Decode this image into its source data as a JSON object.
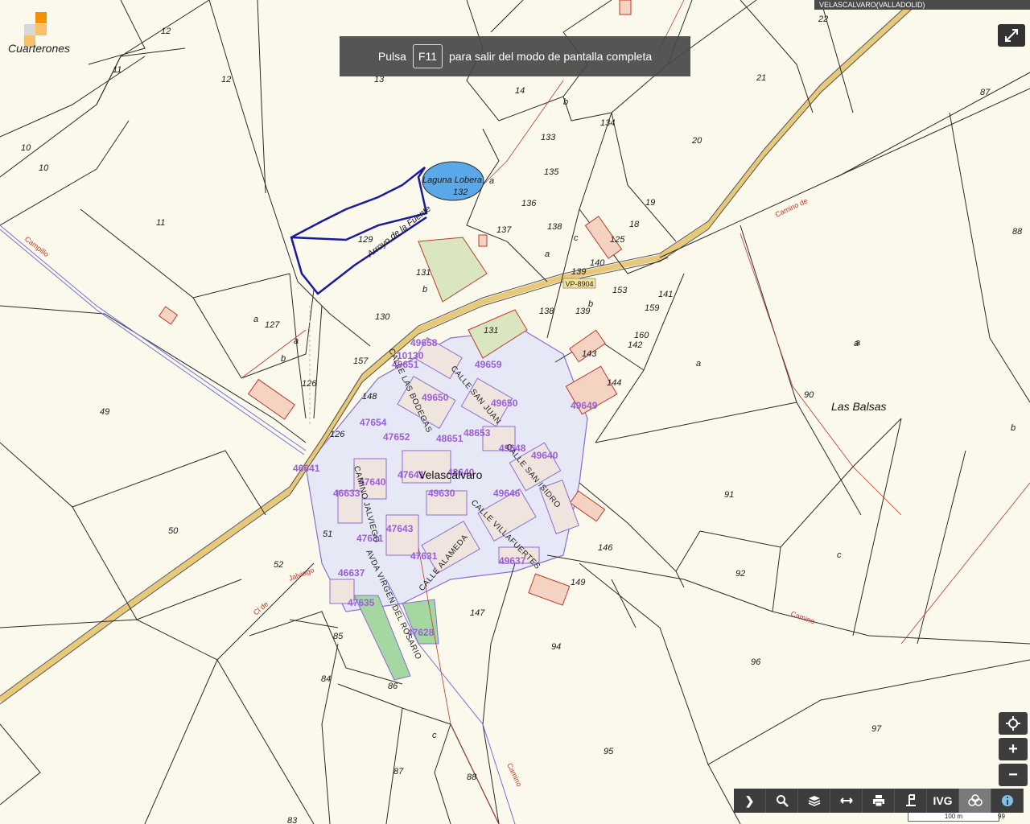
{
  "top_label": "VELASCALVARO(VALLADOLID)",
  "logo_text": "Cuarterones",
  "fullscreen_msg": {
    "before": "Pulsa",
    "key": "F11",
    "after": "para salir del modo de pantalla completa"
  },
  "town_name": "Velascálvaro",
  "place_names": {
    "las_balsas": "Las Balsas",
    "laguna": "Laguna Lobera",
    "arroyo": "Arroyo de la Fuente"
  },
  "road_code": "VP-8904",
  "road_labels": {
    "campillo": "Campillo",
    "camino_de": "Camino de",
    "camino1": "Camino",
    "camino2": "Camino",
    "jalviago": "Jalviago",
    "cl_de": "Cl de",
    "de": "de"
  },
  "streets": {
    "bodegas": "CALLE LAS BODEGAS",
    "san_juan": "CALLE SAN JUAN",
    "san_isidro": "CALLE SAN ISIDRO",
    "villafuertes": "CALLE VILLAFUERTES",
    "alameda": "CALLE ALAMEDA",
    "virgen": "AVDA VIRGEN DEL ROSARIO",
    "viego": "CAMINO JALVIEGO"
  },
  "parcels": [
    "12",
    "11",
    "12",
    "13",
    "14",
    "21",
    "22",
    "87",
    "10",
    "10",
    "11",
    "134",
    "20",
    "133",
    "135",
    "132",
    "136",
    "137",
    "138",
    "19",
    "18",
    "125",
    "88",
    "129",
    "131",
    "140",
    "139",
    "153",
    "141",
    "127",
    "130",
    "131",
    "138",
    "139",
    "159",
    "160",
    "142",
    "143",
    "144",
    "157",
    "126",
    "148",
    "126",
    "90",
    "49",
    "51",
    "52",
    "50",
    "91",
    "146",
    "92",
    "149",
    "147",
    "85",
    "84",
    "86",
    "94",
    "96",
    "97",
    "95",
    "87",
    "88",
    "83"
  ],
  "urban_refs": [
    "49658",
    "10130",
    "49651",
    "49659",
    "49650",
    "49650",
    "49649",
    "47654",
    "47652",
    "48651",
    "48653",
    "49648",
    "49640",
    "46641",
    "47640",
    "47641",
    "48640",
    "49646",
    "46633",
    "49630",
    "47631",
    "47643",
    "47631",
    "46637",
    "49637",
    "47635",
    "47628"
  ],
  "subparcels": [
    "a",
    "b",
    "a",
    "b",
    "a",
    "a",
    "b",
    "a",
    "a",
    "b",
    "c",
    "a",
    "c",
    "b",
    "c"
  ],
  "controls": {
    "locate_icon": "crosshair-icon",
    "zoom_in": "+",
    "zoom_out": "−",
    "toolbar": [
      "chevron-right-icon",
      "search-icon",
      "layers-icon",
      "measure-icon",
      "print-icon",
      "marker-icon",
      "IVG",
      "ortho-icon",
      "info-icon"
    ],
    "ivg_label": "IVG",
    "fullscreen_icon": "expand-icon"
  },
  "scale_label": "100 m",
  "scale_end": "99",
  "colors": {
    "bg": "#fbf8ec",
    "parcel_line": "#2a2a2a",
    "urban": "#8a6fd6",
    "road": "#e8c97a",
    "water": "#5aa8e8",
    "highlight": "#1a1aa0",
    "red_line": "#c0392b"
  }
}
